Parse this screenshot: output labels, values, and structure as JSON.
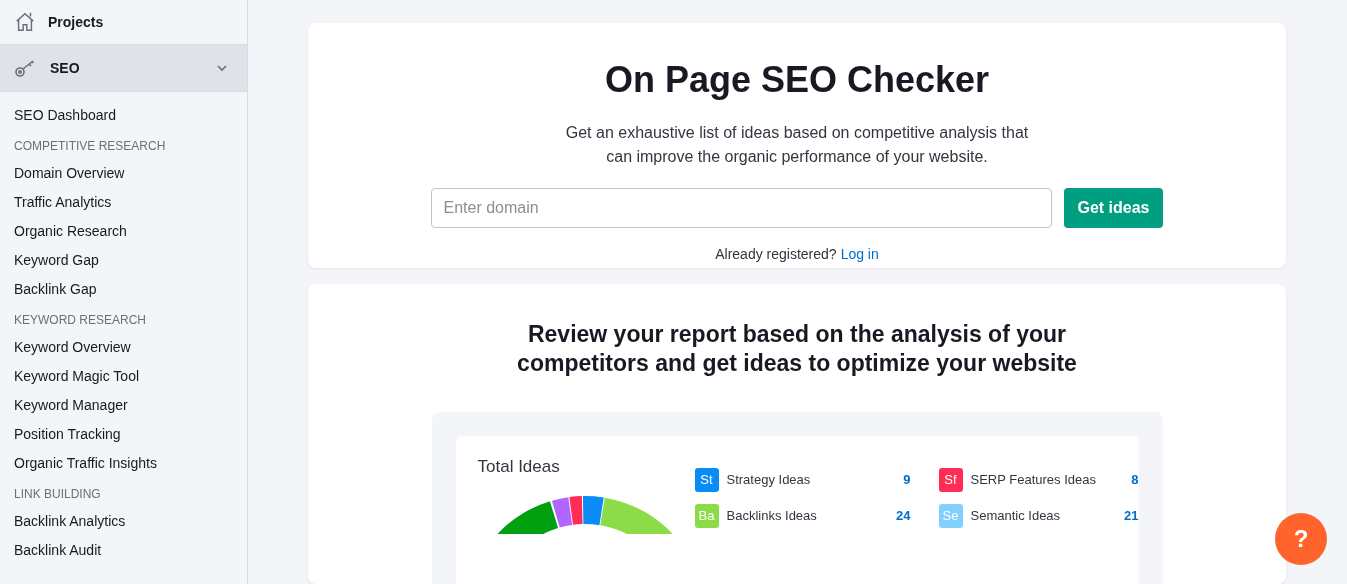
{
  "sidebar": {
    "projects": "Projects",
    "section": {
      "label": "SEO",
      "expanded": true
    },
    "items": [
      {
        "kind": "link",
        "label": "SEO Dashboard"
      },
      {
        "kind": "heading",
        "label": "COMPETITIVE RESEARCH"
      },
      {
        "kind": "link",
        "label": "Domain Overview"
      },
      {
        "kind": "link",
        "label": "Traffic Analytics"
      },
      {
        "kind": "link",
        "label": "Organic Research"
      },
      {
        "kind": "link",
        "label": "Keyword Gap"
      },
      {
        "kind": "link",
        "label": "Backlink Gap"
      },
      {
        "kind": "heading",
        "label": "KEYWORD RESEARCH"
      },
      {
        "kind": "link",
        "label": "Keyword Overview"
      },
      {
        "kind": "link",
        "label": "Keyword Magic Tool"
      },
      {
        "kind": "link",
        "label": "Keyword Manager"
      },
      {
        "kind": "link",
        "label": "Position Tracking"
      },
      {
        "kind": "link",
        "label": "Organic Traffic Insights"
      },
      {
        "kind": "heading",
        "label": "LINK BUILDING"
      },
      {
        "kind": "link",
        "label": "Backlink Analytics"
      },
      {
        "kind": "link",
        "label": "Backlink Audit"
      }
    ]
  },
  "hero": {
    "title": "On Page SEO Checker",
    "subtitle": "Get an exhaustive list of ideas based on competitive analysis that can improve the organic performance of your website.",
    "domain_field": {
      "placeholder": "Enter domain"
    },
    "button": "Get ideas",
    "login_prompt": "Already registered?",
    "login_link": "Log in"
  },
  "report": {
    "title": "Review your report based on the analysis of your competitors and get ideas to optimize your website",
    "total_title": "Total Ideas",
    "legend": [
      {
        "abbr": "St",
        "label": "Strategy Ideas",
        "count": "9",
        "color": "#0a8cf6"
      },
      {
        "abbr": "Sf",
        "label": "SERP Features Ideas",
        "count": "8",
        "color": "#ff2d55"
      },
      {
        "abbr": "Ba",
        "label": "Backlinks Ideas",
        "count": "24",
        "color": "#8bdc48"
      },
      {
        "abbr": "Se",
        "label": "Semantic Ideas",
        "count": "21",
        "color": "#82cfff"
      }
    ]
  },
  "help_button": "?"
}
